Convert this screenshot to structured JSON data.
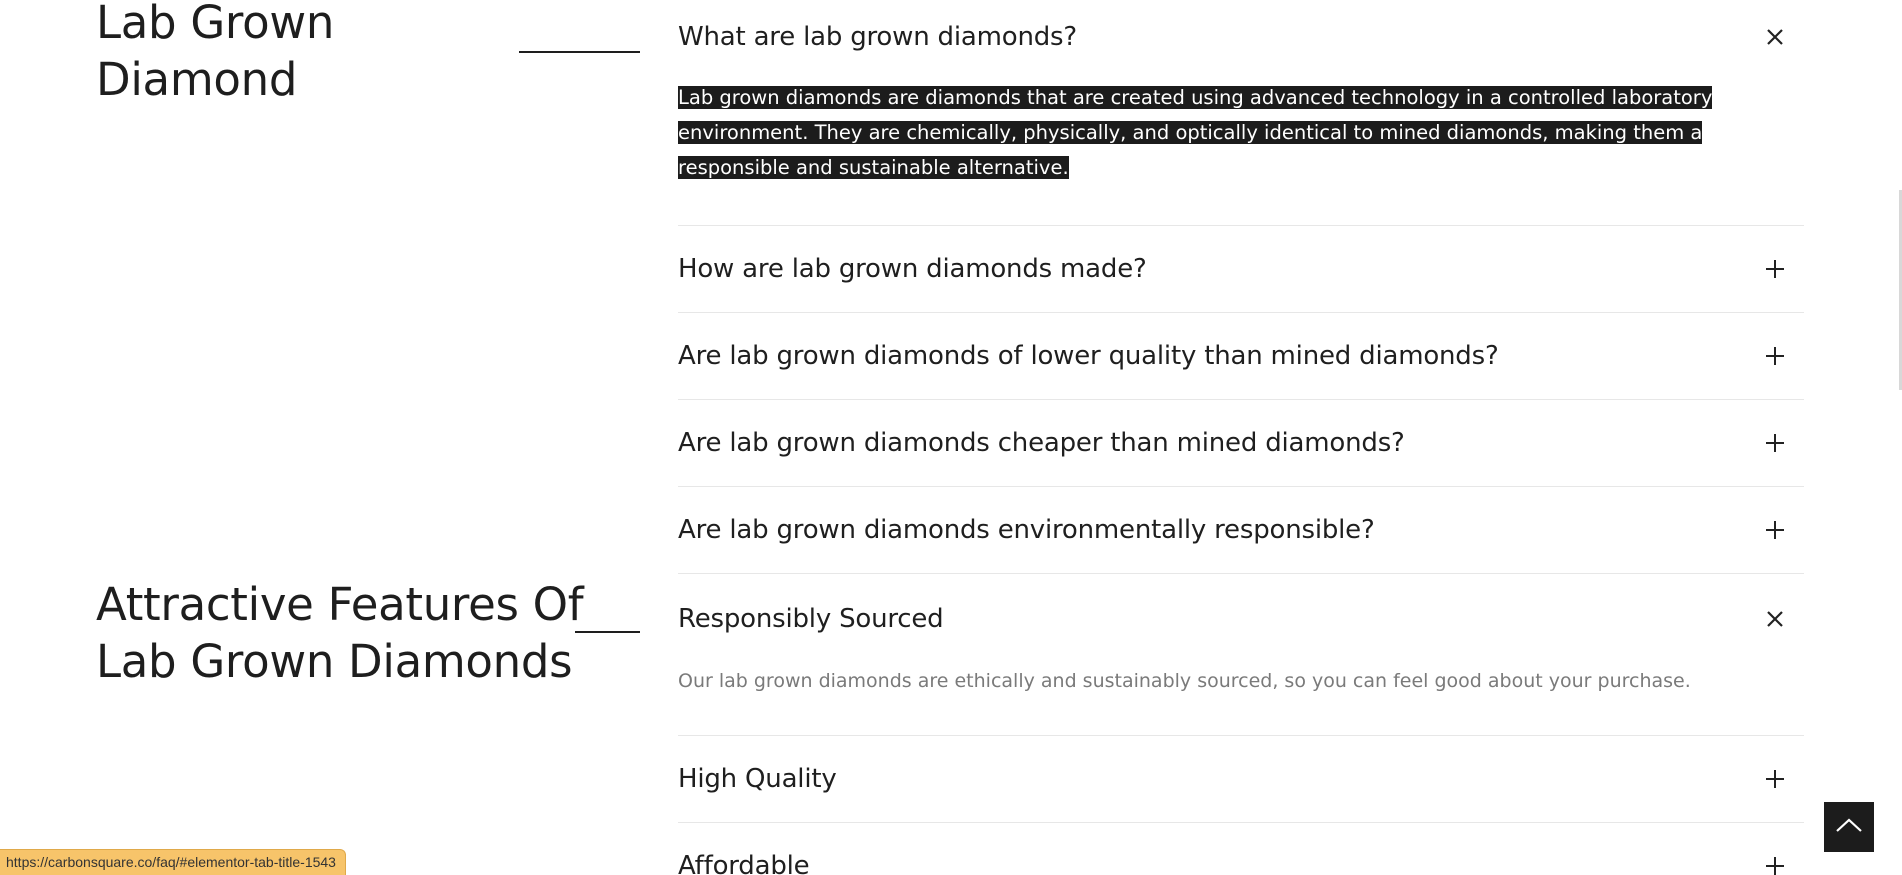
{
  "section1": {
    "title_line1": "Lab Grown",
    "title_line2": "Diamond"
  },
  "faq": {
    "open_item": {
      "question": "What are lab grown diamonds?",
      "answer": "Lab grown diamonds are diamonds that are created using advanced technology in a controlled laboratory environment. They are chemically, physically, and optically identical to mined diamonds, making them a responsible and sustainable alternative.",
      "icon": "close-icon"
    },
    "items": [
      {
        "question": "How are lab grown diamonds made?",
        "icon": "plus-icon"
      },
      {
        "question": "Are lab grown diamonds of lower quality than mined diamonds?",
        "icon": "plus-icon"
      },
      {
        "question": "Are lab grown diamonds cheaper than mined diamonds?",
        "icon": "plus-icon"
      },
      {
        "question": "Are lab grown diamonds environmentally responsible?",
        "icon": "plus-icon"
      }
    ]
  },
  "section2": {
    "title_line1": "Attractive Features Of",
    "title_line2": "Lab Grown Diamonds"
  },
  "features": {
    "open_item": {
      "question": "Responsibly Sourced",
      "answer": "Our lab grown diamonds are ethically and sustainably sourced, so you can feel good about your purchase.",
      "icon": "close-icon"
    },
    "items": [
      {
        "question": "High Quality",
        "icon": "plus-icon"
      },
      {
        "question": "Affordable",
        "icon": "plus-icon"
      }
    ]
  },
  "status_bar": {
    "url": "https://carbonsquare.co/faq/#elementor-tab-title-1543"
  },
  "scroll_top": {
    "icon": "chevron-up-icon"
  },
  "colors": {
    "highlight_bg": "#1c1c1c",
    "status_bg": "#f7c46a"
  }
}
